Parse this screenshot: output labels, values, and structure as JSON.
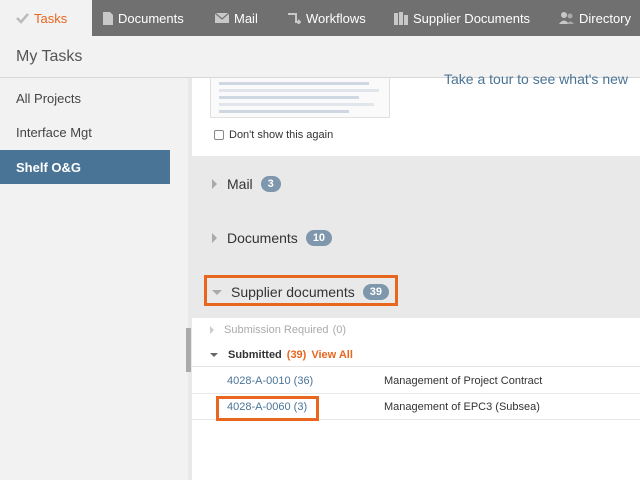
{
  "nav": {
    "tabs": [
      {
        "label": "Tasks",
        "icon": "check-icon",
        "active": true
      },
      {
        "label": "Documents",
        "icon": "document-icon"
      },
      {
        "label": "Mail",
        "icon": "mail-icon"
      },
      {
        "label": "Workflows",
        "icon": "workflow-icon"
      },
      {
        "label": "Supplier Documents",
        "icon": "building-icon"
      },
      {
        "label": "Directory",
        "icon": "people-icon"
      }
    ]
  },
  "header": {
    "title": "My Tasks"
  },
  "sidebar": {
    "items": [
      {
        "label": "All Projects"
      },
      {
        "label": "Interface Mgt"
      },
      {
        "label": "Shelf O&G",
        "active": true
      }
    ]
  },
  "main": {
    "tour_link": "Take a tour to see what's new",
    "dont_show_label": "Don't show this again",
    "sections": [
      {
        "label": "Mail",
        "count": "3"
      },
      {
        "label": "Documents",
        "count": "10"
      },
      {
        "label": "Supplier documents",
        "count": "39"
      }
    ],
    "submission_required": {
      "label": "Submission Required",
      "count": "(0)"
    },
    "submitted": {
      "label": "Submitted",
      "count": "(39)",
      "view_all": "View All"
    },
    "documents": [
      {
        "id": "4028-A-0010 (36)",
        "title": "Management of Project Contract"
      },
      {
        "id": "4028-A-0060 (3)",
        "title": "Management of EPC3 (Subsea)"
      }
    ]
  },
  "colors": {
    "accent": "#e8661e",
    "nav_bg": "#707070",
    "sidebar_active": "#4a7496",
    "badge": "#7e97ad"
  }
}
